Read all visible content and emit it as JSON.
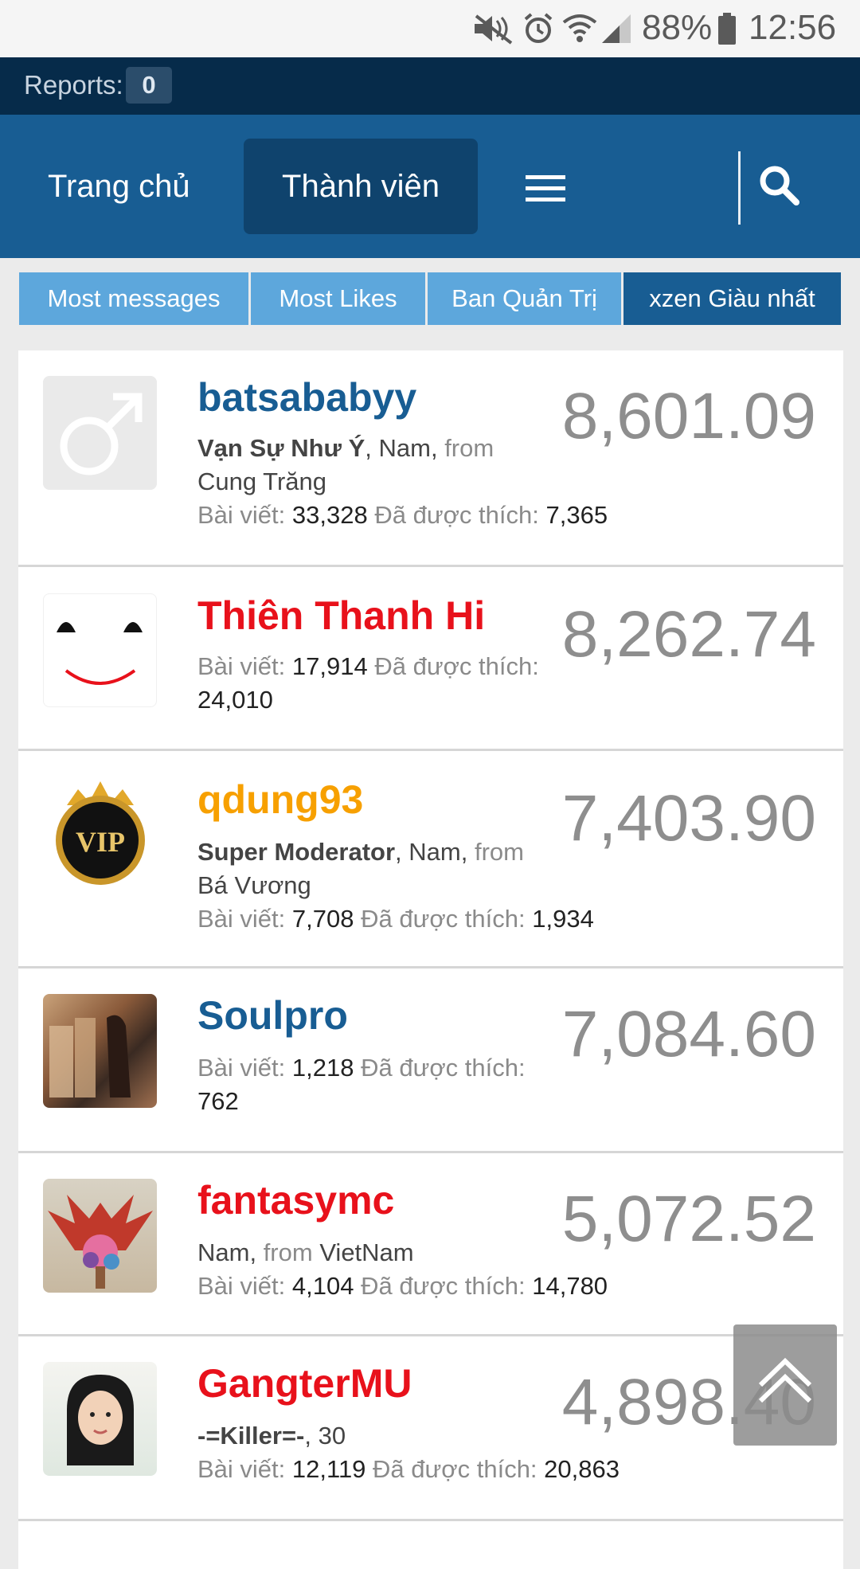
{
  "status_bar": {
    "battery_percent": "88%",
    "time": "12:56",
    "icons": [
      "mute-icon",
      "alarm-icon",
      "wifi-icon",
      "signal-icon",
      "battery-icon"
    ]
  },
  "reports": {
    "label": "Reports:",
    "count": "0"
  },
  "nav": {
    "home": "Trang chủ",
    "members": "Thành viên"
  },
  "filter_tabs": [
    {
      "label": "Most messages"
    },
    {
      "label": "Most Likes"
    },
    {
      "label": "Ban Quản Trị"
    },
    {
      "label": "xzen Giàu nhất"
    }
  ],
  "members": [
    {
      "name": "batsababyy",
      "name_color": "#185d93",
      "score": "8,601.09",
      "title": "Vạn Sự Như Ý",
      "gender": "Nam",
      "from_label": "from",
      "location": "Cung Trăng",
      "posts_label": "Bài viết:",
      "posts": "33,328",
      "likes_label": "Đã được thích:",
      "likes": "7,365"
    },
    {
      "name": "Thiên Thanh Hi",
      "name_color": "#e8111b",
      "score": "8,262.74",
      "posts_label": "Bài viết:",
      "posts": "17,914",
      "likes_label": "Đã được thích:",
      "likes": "24,010"
    },
    {
      "name": "qdung93",
      "name_color": "#f7a000",
      "score": "7,403.90",
      "title": "Super Moderator",
      "gender": "Nam",
      "from_label": "from",
      "location": "Bá Vương",
      "posts_label": "Bài viết:",
      "posts": "7,708",
      "likes_label": "Đã được thích:",
      "likes": "1,934"
    },
    {
      "name": "Soulpro",
      "name_color": "#185d93",
      "score": "7,084.60",
      "posts_label": "Bài viết:",
      "posts": "1,218",
      "likes_label": "Đã được thích:",
      "likes": "762"
    },
    {
      "name": "fantasymc",
      "name_color": "#e8111b",
      "score": "5,072.52",
      "gender": "Nam",
      "from_label": "from",
      "location": "VietNam",
      "posts_label": "Bài viết:",
      "posts": "4,104",
      "likes_label": "Đã được thích:",
      "likes": "14,780"
    },
    {
      "name": "GangterMU",
      "name_color": "#e8111b",
      "score": "4,898.40",
      "title": "-=Killer=-",
      "age": "30",
      "posts_label": "Bài viết:",
      "posts": "12,119",
      "likes_label": "Đã được thích:",
      "likes": "20,863"
    }
  ]
}
